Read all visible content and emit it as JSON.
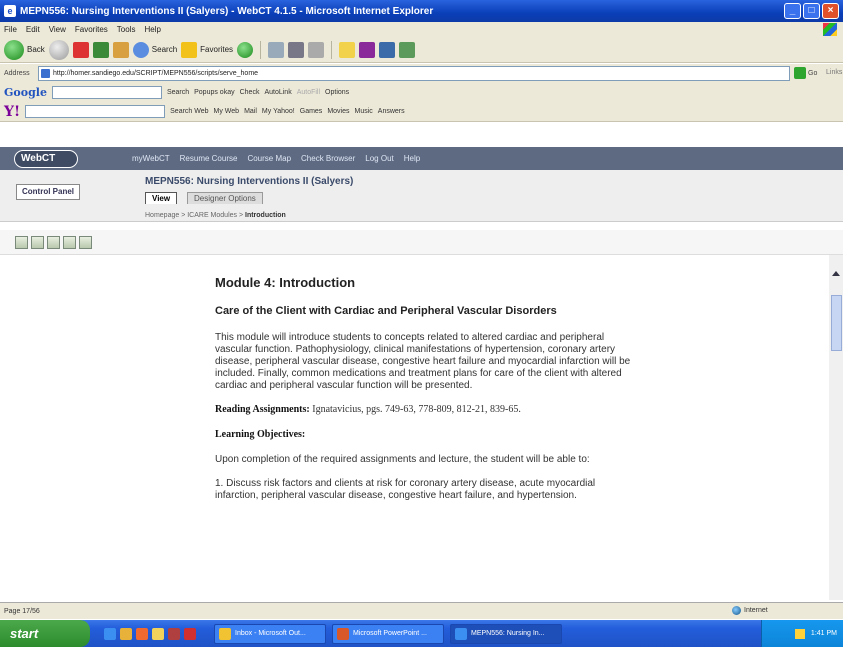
{
  "window": {
    "title": "MEPN556: Nursing Interventions II (Salyers) - WebCT 4.1.5 - Microsoft Internet Explorer",
    "buttons": {
      "minimize": "_",
      "maximize": "□",
      "close": "×"
    }
  },
  "menubar": {
    "items": [
      "File",
      "Edit",
      "View",
      "Favorites",
      "Tools",
      "Help"
    ]
  },
  "toolbar": {
    "back": "Back",
    "search": "Search",
    "favorites": "Favorites"
  },
  "address": {
    "label": "Address",
    "url": "http://homer.sandiego.edu/SCRIPT/MEPN556/scripts/serve_home",
    "go": "Go",
    "links": "Links"
  },
  "googlebar": {
    "logo": "Google",
    "search": "Search",
    "popups": "Popups okay",
    "check": "Check",
    "autolink": "AutoLink",
    "autofill": "AutoFill",
    "options": "Options"
  },
  "yahoobar": {
    "logo": "Y!",
    "search_web": "Search Web",
    "my_web": "My Web",
    "mail": "Mail",
    "my_yahoo": "My Yahoo!",
    "games": "Games",
    "movies": "Movies",
    "music": "Music",
    "answers": "Answers"
  },
  "webct": {
    "logo": "WebCT",
    "nav": [
      "myWebCT",
      "Resume Course",
      "Course Map",
      "Check Browser",
      "Log Out",
      "Help"
    ],
    "control_panel": "Control Panel",
    "course_title": "MEPN556: Nursing Interventions II (Salyers)",
    "tabs": {
      "view": "View",
      "designer": "Designer Options"
    },
    "breadcrumb": {
      "path": "Homepage > ICARE Modules > ",
      "current": "Introduction"
    }
  },
  "content": {
    "heading": "Module 4: Introduction",
    "subheading": "Care of the Client with Cardiac and Peripheral Vascular Disorders",
    "intro": "This module will introduce students to concepts related to altered cardiac and peripheral vascular function. Pathophysiology, clinical manifestations of hypertension, coronary artery disease, peripheral vascular disease, congestive heart failure and myocardial infarction will be included. Finally, common medications and treatment plans for care of the client with altered cardiac and peripheral vascular function will be presented.",
    "reading_label": "Reading Assignments:",
    "reading_text": " Ignatavicius, pgs. 749-63, 778-809, 812-21, 839-65.",
    "objectives_heading": "Learning Objectives:",
    "objectives_intro": "Upon completion of the required assignments and lecture, the student will be able to:",
    "objective_1": "1. Discuss risk factors and clients at risk for coronary artery disease, acute myocardial infarction, peripheral vascular disease, congestive heart failure, and hypertension."
  },
  "status": {
    "text": "Page 17/56",
    "zone": "Internet"
  },
  "taskbar": {
    "start": "start",
    "tasks": [
      "Inbox - Microsoft Out...",
      "Microsoft PowerPoint ...",
      "MEPN556: Nursing In..."
    ],
    "clock": "1:41 PM"
  },
  "colors": {
    "title_blue": "#0a3fb8",
    "webct_nav": "#5d6a82",
    "course_title": "#3a4a6a",
    "taskbar": "#245edb",
    "start_green": "#2c8c2c"
  }
}
